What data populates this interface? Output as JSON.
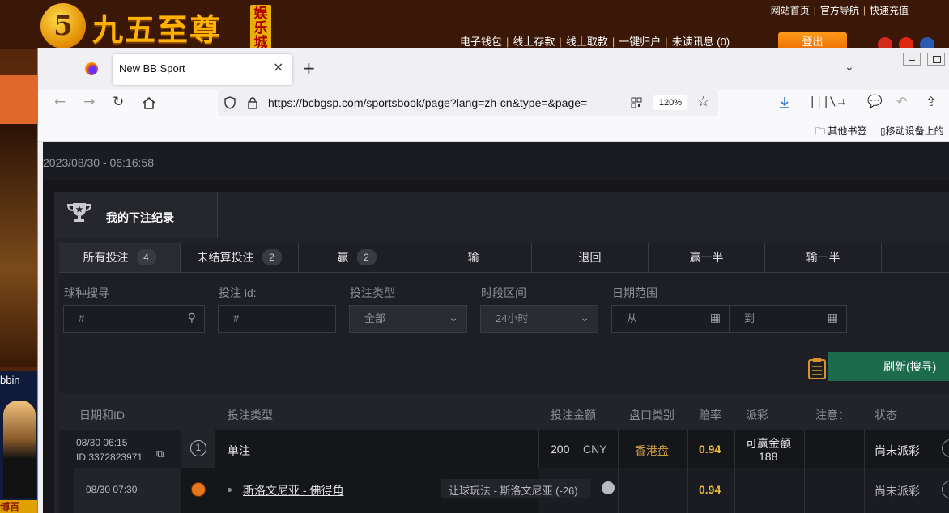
{
  "background_site": {
    "logo_number": "5",
    "logo_text": "九五至尊",
    "logo_badge": "娱乐城",
    "top_links": [
      "网站首页",
      "官方导航",
      "快速充值"
    ],
    "mid_links": [
      "电子钱包",
      "线上存款",
      "线上取款",
      "一键归户",
      "未读讯息 (0)"
    ],
    "logout_label": "登出",
    "ad_brand": "bbin",
    "ad_bottom_text": "博百"
  },
  "browser": {
    "tab_title": "New BB Sport",
    "tab_close": "×",
    "new_tab": "+",
    "tab_list": "⌄",
    "url": "https://bcbgsp.com/sportsbook/page?lang=zh-cn&type=&page=",
    "zoom": "120%",
    "bookmarks": [
      "其他书签",
      "移动设备上的"
    ]
  },
  "page": {
    "datetime": "2023/08/30 - 06:16:58",
    "panel_title": "我的下注纪录",
    "filter_tabs": [
      {
        "label": "所有投注",
        "count": "4"
      },
      {
        "label": "未结算投注",
        "count": "2"
      },
      {
        "label": "赢",
        "count": "2"
      },
      {
        "label": "输",
        "count": ""
      },
      {
        "label": "退回",
        "count": ""
      },
      {
        "label": "赢一半",
        "count": ""
      },
      {
        "label": "输一半",
        "count": ""
      }
    ],
    "filters": {
      "sport_search_label": "球种搜寻",
      "sport_search_placeholder": "#",
      "bet_id_label": "投注 id:",
      "bet_id_placeholder": "#",
      "bet_type_label": "投注类型",
      "bet_type_value": "全部",
      "period_label": "时段区间",
      "period_value": "24小时",
      "date_range_label": "日期范围",
      "date_from_placeholder": "从",
      "date_to_placeholder": "到"
    },
    "refresh_label": "刷新(搜寻)",
    "table": {
      "headers": [
        "日期和ID",
        "投注类型",
        "投注金额",
        "盘口类别",
        "赔率",
        "派彩",
        "注意：",
        "状态"
      ],
      "row1": {
        "date": "08/30 06:15",
        "id": "ID:3372823971",
        "index": "1",
        "bet_type": "单注",
        "amount": "200",
        "currency": "CNY",
        "market": "香港盘",
        "odds": "0.94",
        "payout_label": "可赢金额",
        "payout_value": "188",
        "status": "尚未派彩"
      },
      "row2": {
        "date": "08/30 07:30",
        "match": "斯洛文尼亚 - 佛得角",
        "bet_detail": "让球玩法 - 斯洛文尼亚 (-26)",
        "odds": "0.94",
        "status": "尚未派彩"
      }
    }
  },
  "colors": {
    "accent_green": "#1c6b4e",
    "odds_gold": "#f0b83c",
    "market_gold": "#c79b45"
  }
}
